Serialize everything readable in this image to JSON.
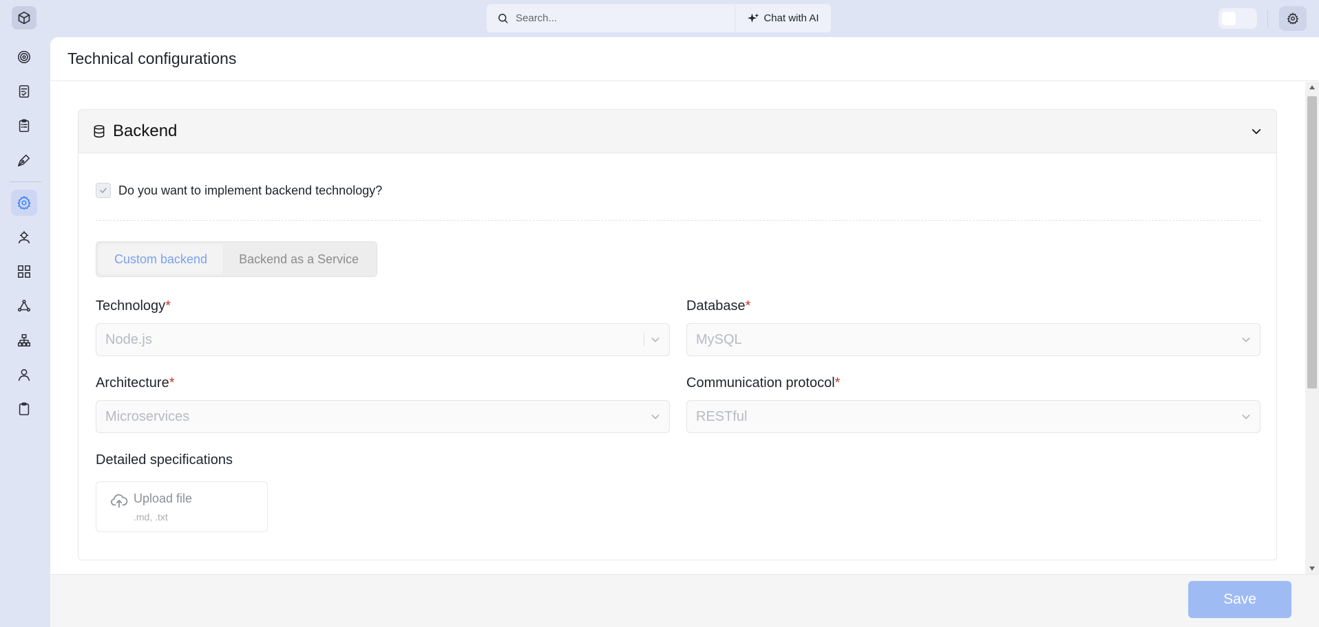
{
  "topbar": {
    "search_placeholder": "Search...",
    "chat_label": "Chat with AI",
    "theme_toggle_on": false
  },
  "sidebar": {
    "items": [
      {
        "icon": "target-icon",
        "active": false
      },
      {
        "icon": "document-check-icon",
        "active": false
      },
      {
        "icon": "clipboard-list-icon",
        "active": false
      },
      {
        "icon": "pen-tool-icon",
        "active": false
      },
      {
        "icon": "gear-icon",
        "active": true
      },
      {
        "icon": "user-gear-icon",
        "active": false
      },
      {
        "icon": "layout-grid-icon",
        "active": false
      },
      {
        "icon": "workflow-icon",
        "active": false
      },
      {
        "icon": "hierarchy-icon",
        "active": false
      },
      {
        "icon": "user-icon",
        "active": false
      },
      {
        "icon": "clipboard-icon",
        "active": false
      }
    ]
  },
  "page": {
    "title": "Technical configurations"
  },
  "backend": {
    "title": "Backend",
    "implement_label": "Do you want to implement backend technology?",
    "implement_checked": true,
    "tabs": [
      {
        "label": "Custom backend",
        "active": true
      },
      {
        "label": "Backend as a Service",
        "active": false
      }
    ],
    "technology": {
      "label": "Technology",
      "required_mark": "*",
      "value": "Node.js"
    },
    "database": {
      "label": "Database",
      "required_mark": "*",
      "value": "MySQL"
    },
    "architecture": {
      "label": "Architecture",
      "required_mark": "*",
      "value": "Microservices"
    },
    "protocol": {
      "label": "Communication protocol",
      "required_mark": "*",
      "value": "RESTful"
    },
    "specs": {
      "label": "Detailed specifications",
      "upload_label": "Upload file",
      "upload_hint": ".md, .txt"
    }
  },
  "footer": {
    "save_label": "Save"
  },
  "colors": {
    "accent": "#3b82f6",
    "save_button": "#9ebbf4",
    "active_tab_text": "#7aa2ef",
    "required": "#c0392b"
  }
}
